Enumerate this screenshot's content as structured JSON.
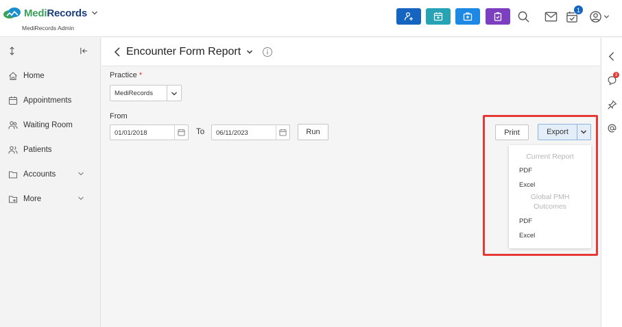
{
  "header": {
    "brand_medi": "Medi",
    "brand_records": "Records",
    "subtitle": "MediRecords Admin",
    "quick_actions": [
      {
        "icon": "add-patient-icon",
        "color": "#1565c0"
      },
      {
        "icon": "calendar-icon",
        "color": "#26a3b5"
      },
      {
        "icon": "medical-bag-icon",
        "color": "#1e88e5"
      },
      {
        "icon": "clipboard-icon",
        "color": "#7b3fbf"
      }
    ],
    "task_badge": "1"
  },
  "sidebar": {
    "items": [
      {
        "label": "Home",
        "icon": "home-icon"
      },
      {
        "label": "Appointments",
        "icon": "calendar-icon"
      },
      {
        "label": "Waiting Room",
        "icon": "people-icon"
      },
      {
        "label": "Patients",
        "icon": "patients-icon"
      },
      {
        "label": "Accounts",
        "icon": "folder-icon"
      },
      {
        "label": "More",
        "icon": "folder-plus-icon"
      }
    ]
  },
  "page": {
    "title": "Encounter Form Report",
    "practice_label": "Practice",
    "required_mark": "*",
    "practice_value": "MediRecords",
    "from_label": "From",
    "from_date": "01/01/2018",
    "to_label": "To",
    "to_date": "06/11/2023",
    "run_label": "Run",
    "print_label": "Print",
    "export_label": "Export"
  },
  "export_menu": {
    "current_heading": "Current Report",
    "current_items": [
      "PDF",
      "Excel"
    ],
    "global_heading_line1": "Global PMH",
    "global_heading_line2": "Outcomes",
    "global_items": [
      "PDF",
      "Excel"
    ]
  },
  "right_rail": {
    "chat_badge": "3"
  }
}
